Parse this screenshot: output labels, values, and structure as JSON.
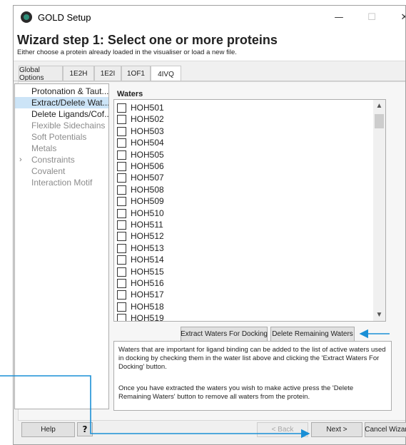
{
  "window": {
    "title": "GOLD Setup",
    "minimize": "—",
    "maximize": "☐",
    "close": "✕"
  },
  "header": {
    "title": "Wizard step 1: Select one or more proteins",
    "subtitle": "Either choose a protein already loaded in the visualiser or load a new file."
  },
  "tabs": [
    {
      "label": "Global Options"
    },
    {
      "label": "1E2H"
    },
    {
      "label": "1E2I"
    },
    {
      "label": "1OF1"
    },
    {
      "label": "4IVQ",
      "active": true
    }
  ],
  "tree": {
    "items": [
      {
        "label": "Protonation & Taut...",
        "enabled": true
      },
      {
        "label": "Extract/Delete Wat...",
        "enabled": true,
        "selected": true
      },
      {
        "label": "Delete Ligands/Cof...",
        "enabled": true
      },
      {
        "label": "Flexible Sidechains",
        "enabled": false
      },
      {
        "label": "Soft Potentials",
        "enabled": false
      },
      {
        "label": "Metals",
        "enabled": false
      },
      {
        "label": "Constraints",
        "enabled": false,
        "expandable": true
      },
      {
        "label": "Covalent",
        "enabled": false
      },
      {
        "label": "Interaction Motif",
        "enabled": false
      }
    ],
    "expand_arrow": "›"
  },
  "waters": {
    "label": "Waters",
    "items": [
      "HOH501",
      "HOH502",
      "HOH503",
      "HOH504",
      "HOH505",
      "HOH506",
      "HOH507",
      "HOH508",
      "HOH509",
      "HOH510",
      "HOH511",
      "HOH512",
      "HOH513",
      "HOH514",
      "HOH515",
      "HOH516",
      "HOH517",
      "HOH518",
      "HOH519"
    ],
    "scroll_up": "▲",
    "scroll_down": "▼"
  },
  "buttons": {
    "extract": "Extract Waters For Docking",
    "delete_remaining": "Delete Remaining Waters",
    "help": "Help",
    "back": "< Back",
    "next": "Next >",
    "cancel": "Cancel Wizar"
  },
  "info": {
    "para1": "Waters that are important for ligand binding can be added to the list of active waters used in docking by checking them in the water list above and clicking the 'Extract Waters For Docking' button.",
    "para2": "Once you have extracted the waters you wish to make active press the 'Delete Remaining Waters' button to remove all waters from the protein."
  },
  "colors": {
    "annotation_arrow": "#1a8fd6",
    "selection": "#cce4f7"
  },
  "icons": {
    "whats_this": "?"
  }
}
